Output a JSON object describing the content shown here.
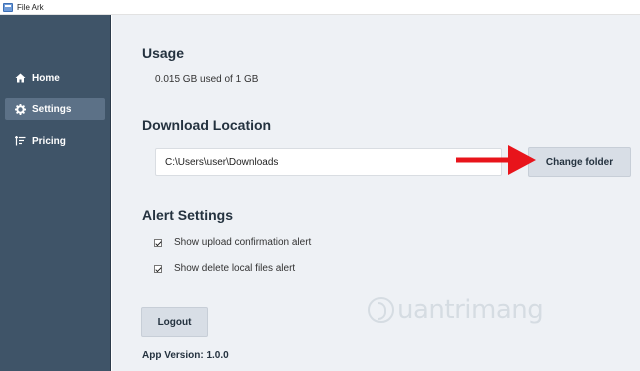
{
  "window": {
    "title": "File Ark"
  },
  "sidebar": {
    "items": [
      {
        "label": "Home",
        "icon": "home-icon",
        "active": false
      },
      {
        "label": "Settings",
        "icon": "gear-icon",
        "active": true
      },
      {
        "label": "Pricing",
        "icon": "sort-icon",
        "active": false
      }
    ]
  },
  "usage": {
    "heading": "Usage",
    "text": "0.015 GB used of 1 GB"
  },
  "download": {
    "heading": "Download Location",
    "path": "C:\\Users\\user\\Downloads",
    "button_label": "Change folder"
  },
  "alerts": {
    "heading": "Alert Settings",
    "options": [
      {
        "label": "Show upload confirmation alert",
        "checked": true
      },
      {
        "label": "Show delete local files alert",
        "checked": true
      }
    ]
  },
  "logout_label": "Logout",
  "app_version": "App Version: 1.0.0",
  "watermark": "uantrimang",
  "colors": {
    "sidebar": "#3f5468",
    "main_bg": "#eef1f5",
    "accent_arrow": "#e8141b",
    "button_bg": "#d8dee6"
  }
}
